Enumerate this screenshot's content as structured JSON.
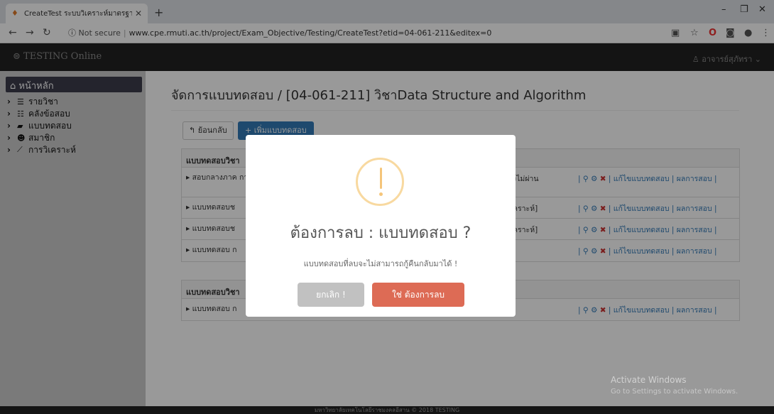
{
  "browser": {
    "tab_title": "CreateTest ระบบวิเคราะห์มาตรฐานข้",
    "new_tab": "+",
    "url_status": "Not secure",
    "url": "www.cpe.rmuti.ac.th/project/Exam_Objective/Testing/CreateTest?etid=04-061-211&editex=0"
  },
  "navbar": {
    "brand": "TESTING Online",
    "user": "อาจารย์สุภัทรา"
  },
  "sidebar": {
    "home": "หน้าหลัก",
    "items": [
      {
        "label": "รายวิชา",
        "icon": "list-icon"
      },
      {
        "label": "คลังข้อสอบ",
        "icon": "database-icon"
      },
      {
        "label": "แบบทดสอบ",
        "icon": "book-icon"
      },
      {
        "label": "สมาชิก",
        "icon": "users-icon"
      },
      {
        "label": "การวิเคราะห์",
        "icon": "chart-icon"
      }
    ]
  },
  "main": {
    "title": "จัดการแบบทดสอบ / [04-061-211] วิชาData Structure and Algorithm",
    "back_label": "ย้อนกลับ",
    "add_label": "เพิ่มแบบทดสอบ",
    "panel1_head": "แบบทดสอบวิชา",
    "panel1_rows": [
      {
        "name": "สอบกลางภาค การวิเคราะห์]",
        "mid": "งไม่ผ่าน"
      },
      {
        "name": "แบบทดสอบช",
        "mid": "คราะห์]"
      },
      {
        "name": "แบบทดสอบช",
        "mid": "คราะห์]"
      },
      {
        "name": "แบบทดสอบ ก",
        "mid": ""
      }
    ],
    "panel2_head": "แบบทดสอบวิชา",
    "panel2_rows": [
      {
        "name": "แบบทดสอบ ก",
        "mid": ""
      }
    ],
    "actions": {
      "edit": "แก้ไขแบบทดสอบ",
      "results": "ผลการสอบ"
    }
  },
  "modal": {
    "title": "ต้องการลบ : แบบทดสอบ ?",
    "text": "แบบทดสอบที่ลบจะไม่สามารถกู้คืนกลับมาได้ !",
    "cancel_label": "ยกเลิก !",
    "confirm_label": "ใช่ ต้องการลบ"
  },
  "footer": "มหาวิทยาลัยเทคโนโลยีราชมงคลอีสาน © 2018 TESTING",
  "watermark": {
    "line1": "Activate Windows",
    "line2": "Go to Settings to activate Windows."
  }
}
